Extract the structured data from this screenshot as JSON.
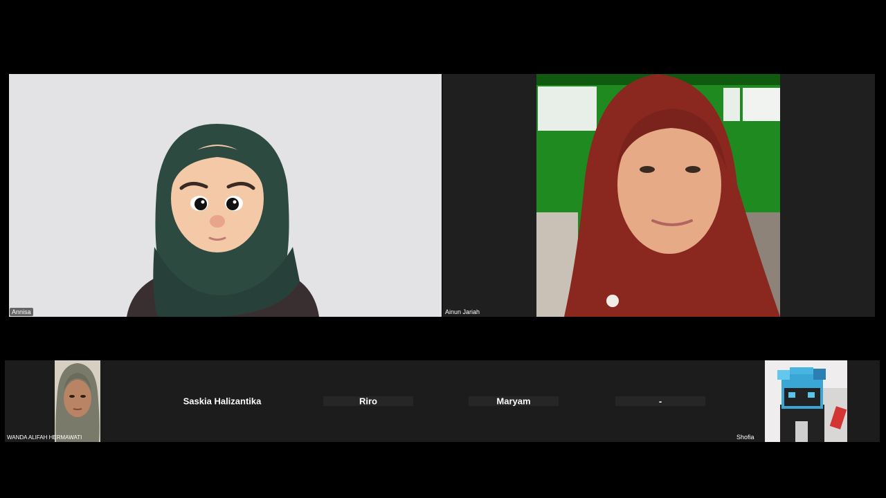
{
  "meeting": {
    "participants": [
      {
        "name": "Annisa"
      },
      {
        "name": "Ainun Jariah"
      },
      {
        "name": "WANDA ALIFAH HERMAWATI"
      },
      {
        "name": "Saskia Halizantika"
      },
      {
        "name": "Riro"
      },
      {
        "name": "Maryam"
      },
      {
        "name": "-"
      },
      {
        "name": "Shofia"
      }
    ]
  },
  "colors": {
    "background": "#000000",
    "tile": "#1f1f1f",
    "avatar_bg": "#e3e3e5",
    "hijab_green": "#2d4a40",
    "hijab_red": "#8a2820",
    "wall_green": "#1f8a1f"
  }
}
